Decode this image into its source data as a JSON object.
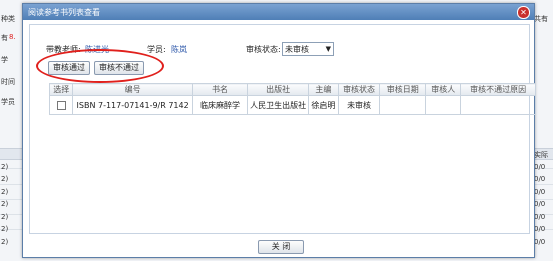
{
  "background": {
    "left_fragments": [
      "种类",
      "有",
      "8.",
      "学",
      "时间",
      "学员",
      "2)",
      "2)",
      "2)",
      "2)",
      "2)",
      "2)",
      "2)"
    ],
    "right_fragments": [
      "共有",
      "实际",
      "0/0",
      "0/0",
      "0/0",
      "0/0",
      "0/0",
      "0/0",
      "0/0"
    ]
  },
  "dialog": {
    "title": "阅读参考书列表查看",
    "close_icon": "close-icon",
    "filters": {
      "teacher_label": "带教老师:",
      "teacher_value": "陈进光",
      "student_label": "学员:",
      "student_value": "陈岚",
      "status_label": "审核状态:",
      "status_value": "未审核"
    },
    "buttons": {
      "approve": "审核通过",
      "reject": "审核不通过",
      "close": "关 闭"
    },
    "table": {
      "headers": [
        "选择",
        "编号",
        "书名",
        "出版社",
        "主编",
        "审核状态",
        "审核日期",
        "审核人",
        "审核不通过原因"
      ],
      "rows": [
        [
          "",
          "ISBN 7-117-07141-9/R 7142",
          "临床麻醉学",
          "人民卫生出版社",
          "徐启明",
          "未审核",
          "",
          "",
          ""
        ]
      ]
    }
  }
}
